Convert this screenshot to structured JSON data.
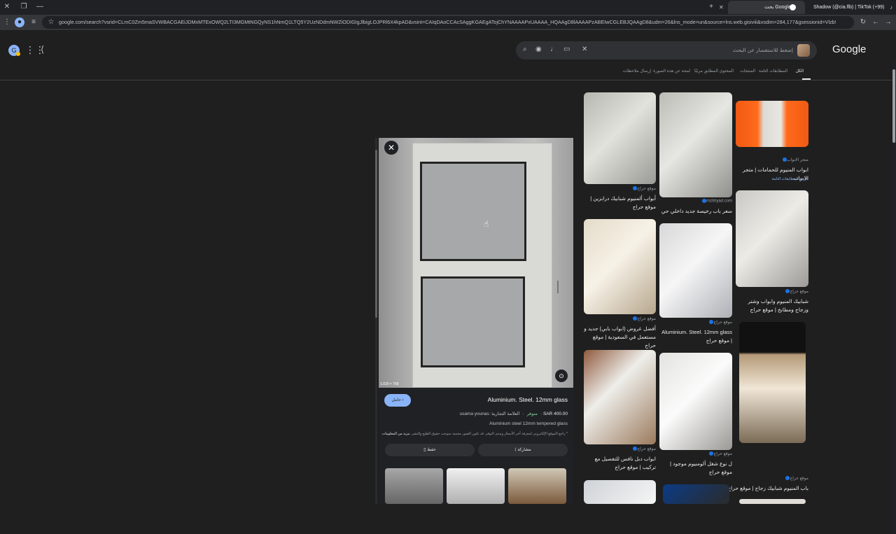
{
  "browser": {
    "tabs": [
      {
        "title": "بحث Google",
        "active": true
      },
      {
        "title": "Shadow (@cia.flb) | TikTok (+99)",
        "active": false
      }
    ],
    "url": "google.com/search?vsrid=CLmC0Zm5maSVWBACGAEiJDMxMTExOWQ2LTI3MGMtNGQyNS1hNmQ1LTQ5Y2UzNDdmNWZiODIGIgJlbigLOJPRl6X4kpAD&vsint=CAIqDAoCCAcSAggKGAEgATojChYNAAAAPxUAAAA_HQAAgD8lAAAAPzABEIwCGLEBJQAAgD8&udm=26&lns_mode=un&source=lns.web.gisiviii&vsdim=284,177&gsessionid=Vlzb9UmLEj1vlzFezEJ94C6T..."
  },
  "google": {
    "logo": "Google",
    "search_placeholder": "إضغط للاستفسار عن البحث"
  },
  "filter_tabs": [
    "الكل",
    "المطابقات التامة",
    "المنتجات",
    "المحتوى المطابق مرئيًا",
    "لمحة عن هذه الصورة",
    "إرسال ملاحظات"
  ],
  "detail": {
    "resolution": "1,020 × 768",
    "visit_label": "حامل",
    "title": "Aluminium. Steel. 12mm glass",
    "price": "SAR 400.00",
    "stock": "متوفر",
    "brand": "العلامة التجارية: usama younas",
    "description": "Aluminium steel 12mm tempered glass",
    "note_text": "* راجع الموقع الإلكتروني لمعرفة آخر الأسعار ومدى التوفر. قد تكون الصور محمية بموجب حقوق الطبع والنشر.",
    "note_more": "مزيد من المعلومات",
    "save_label": "حفظ",
    "share_label": "مشاركة"
  },
  "results": [
    {
      "source": "موقع حراج",
      "title": "أبواب ألمنيوم شبابيك درابزين | موقع حراج"
    },
    {
      "source": "mzitriyad.com",
      "title": "سعر باب رخيصة جديد داخلي حي المبا..."
    },
    {
      "source": "متجر الابواب",
      "title": "ابواب المنيوم للحمامات | متجر الابواب",
      "extra": "عرض المطابقات التامة"
    },
    {
      "source": "موقع حراج",
      "title": "أفضل عروض (ابواب بابي) جديد و مستعمل في السعودية | موقع حراج"
    },
    {
      "source": "موقع حراج",
      "title": "Aluminium. Steel. 12mm glass | موقع حراج"
    },
    {
      "source": "موقع حراج",
      "title": "شبابيك المنيوم وابواب وشتر وزجاج ومطابخ | موقع حراج"
    },
    {
      "source": "موقع حراج",
      "title": "ابواب دبل نافس للتفصيل مع تركيب | موقع حراج"
    },
    {
      "source": "موقع حراج",
      "title": "ل نوع شغل ألومنيوم موجود | موقع حراج"
    },
    {
      "source": "موقع حراج",
      "title": "باب المنيوم شبابيك زجاج | موقع حراج"
    }
  ]
}
